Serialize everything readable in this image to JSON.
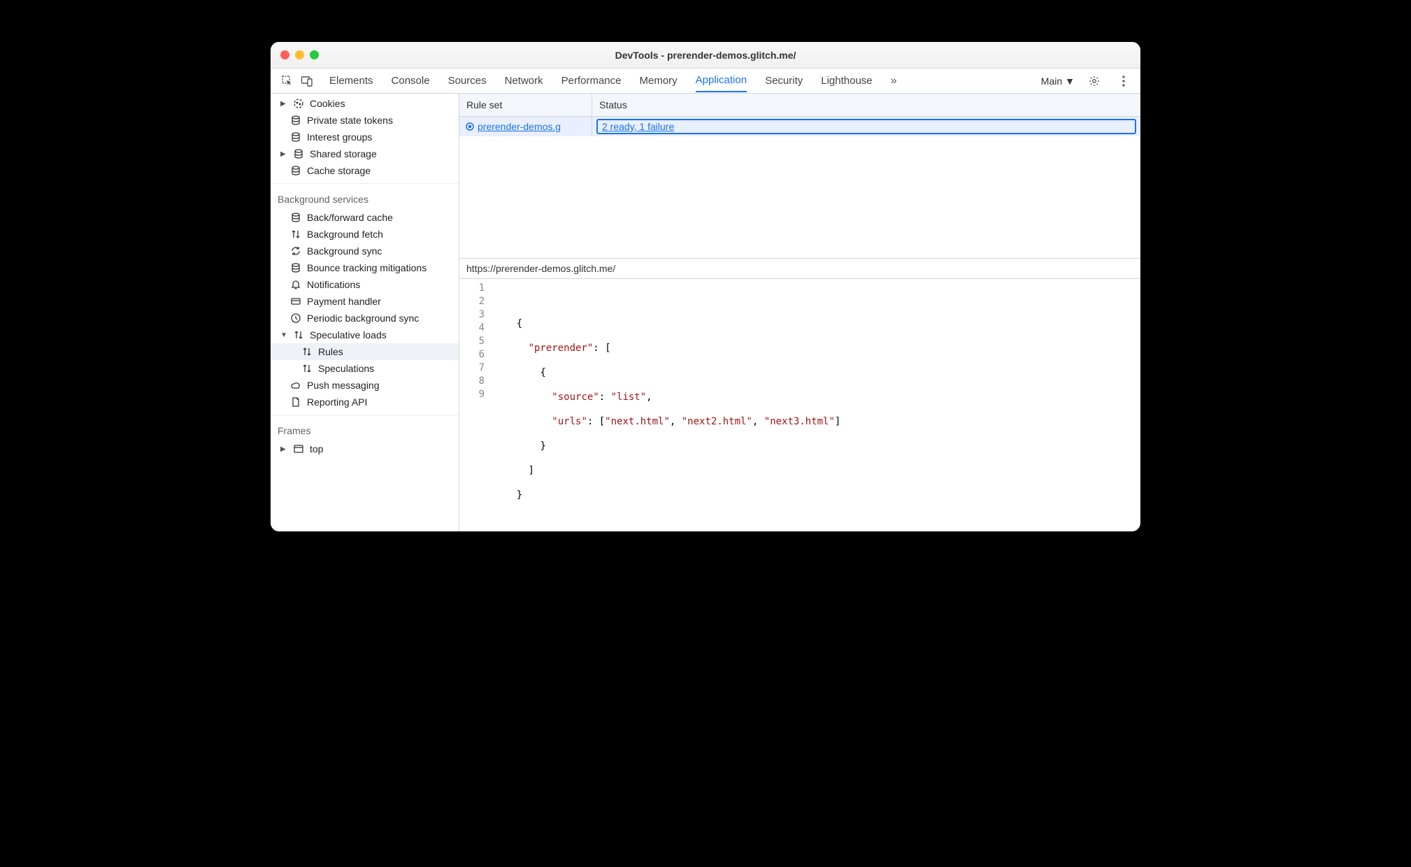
{
  "window": {
    "title": "DevTools - prerender-demos.glitch.me/"
  },
  "tabs": {
    "elements": "Elements",
    "console": "Console",
    "sources": "Sources",
    "network": "Network",
    "performance": "Performance",
    "memory": "Memory",
    "application": "Application",
    "security": "Security",
    "lighthouse": "Lighthouse"
  },
  "frame_selector": "Main",
  "sidebar": {
    "storage": {
      "cookies": "Cookies",
      "private_state_tokens": "Private state tokens",
      "interest_groups": "Interest groups",
      "shared_storage": "Shared storage",
      "cache_storage": "Cache storage"
    },
    "bg_title": "Background services",
    "bg": {
      "back_forward_cache": "Back/forward cache",
      "background_fetch": "Background fetch",
      "background_sync": "Background sync",
      "bounce_tracking": "Bounce tracking mitigations",
      "notifications": "Notifications",
      "payment_handler": "Payment handler",
      "periodic_bg_sync": "Periodic background sync",
      "speculative_loads": "Speculative loads",
      "rules": "Rules",
      "speculations": "Speculations",
      "push_messaging": "Push messaging",
      "reporting_api": "Reporting API"
    },
    "frames_title": "Frames",
    "frames_top": "top"
  },
  "grid": {
    "col_rule": "Rule set",
    "col_status": "Status",
    "row1_rule": "prerender-demos.g",
    "row1_status": "2 ready, 1 failure"
  },
  "detail": {
    "url": "https://prerender-demos.glitch.me/"
  },
  "code": {
    "lines": [
      "1",
      "2",
      "3",
      "4",
      "5",
      "6",
      "7",
      "8",
      "9"
    ],
    "json": {
      "key_prerender": "\"prerender\"",
      "key_source": "\"source\"",
      "val_source": "\"list\"",
      "key_urls": "\"urls\"",
      "url1": "\"next.html\"",
      "url2": "\"next2.html\"",
      "url3": "\"next3.html\""
    }
  }
}
